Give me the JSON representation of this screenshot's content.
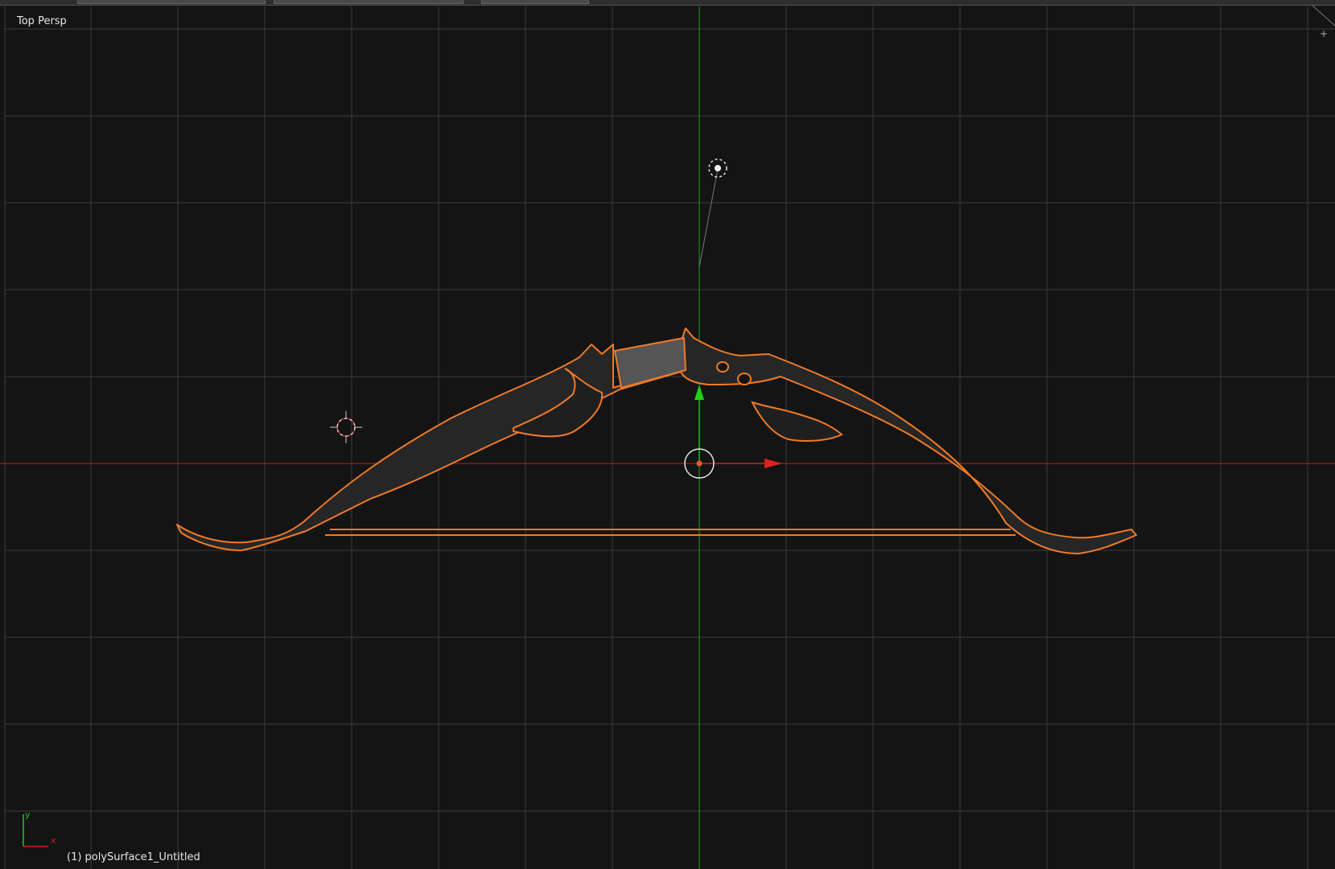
{
  "viewport": {
    "view_name": "Top Persp",
    "active_object": "(1) polySurface1_Untitled"
  },
  "axis_widget": {
    "y_label": "y",
    "x_label": "x"
  },
  "icons": {
    "lamp": "lamp-icon",
    "cursor": "3d-cursor-icon",
    "manipulator": "transform-manipulator-icon",
    "corner": "split-corner-icon"
  },
  "colors": {
    "background": "#141414",
    "grid": "#3c3c3c",
    "x_axis": "#b02020",
    "y_axis": "#1fa01f",
    "selection_outline": "#f07a28",
    "mesh": "#2a2a2a",
    "text": "#e6e6e6"
  }
}
